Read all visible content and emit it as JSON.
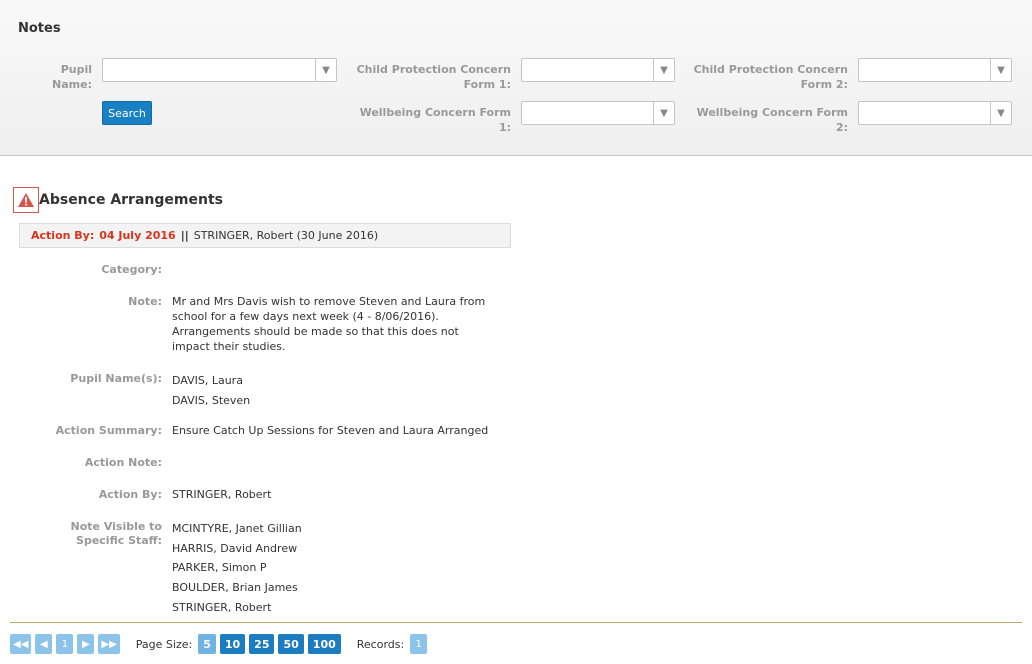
{
  "header": {
    "title": "Notes"
  },
  "filters": {
    "pupil_name": {
      "label_line1": "Pupil",
      "label_line2": "Name:",
      "value": ""
    },
    "cp_form1": {
      "label_line1": "Child Protection Concern",
      "label_line2": "Form 1:",
      "value": ""
    },
    "cp_form2": {
      "label_line1": "Child Protection Concern",
      "label_line2": "Form 2:",
      "value": ""
    },
    "wb_form1": {
      "label_line1": "Wellbeing Concern Form",
      "label_line2": "1:",
      "value": ""
    },
    "wb_form2": {
      "label_line1": "Wellbeing Concern Form",
      "label_line2": "2:",
      "value": ""
    },
    "search_label": "Search",
    "dropdown_icon": "chevron-down-icon"
  },
  "note": {
    "title": "Absence Arrangements",
    "alert_icon": "warning-icon",
    "alert_color": "#d9534f",
    "action_by_label": "Action By:",
    "action_by_date": "04 July 2016",
    "separator": "||",
    "author_info": "STRINGER, Robert (30 June 2016)",
    "fields": {
      "category_label": "Category:",
      "category_value": "",
      "note_label": "Note:",
      "note_lines": [
        "Mr and Mrs Davis wish to remove Steven and Laura from",
        "school for a few days next week (4 - 8/06/2016).",
        "Arrangements should be made so that this does not",
        "impact their studies."
      ],
      "pupils_label": "Pupil Name(s):",
      "pupils": [
        "DAVIS, Laura",
        "DAVIS, Steven"
      ],
      "action_summary_label": "Action Summary:",
      "action_summary": "Ensure Catch Up Sessions for Steven and Laura Arranged",
      "action_note_label": "Action Note:",
      "action_note": "",
      "action_by_label": "Action By:",
      "action_by": "STRINGER, Robert",
      "visible_label_line1": "Note Visible to",
      "visible_label_line2": "Specific Staff:",
      "visible_staff": [
        "MCINTYRE, Janet Gillian",
        "HARRIS, David Andrew",
        "PARKER, Simon P",
        "BOULDER, Brian James",
        "STRINGER, Robert"
      ]
    }
  },
  "pager": {
    "first_icon": "first-page-icon",
    "prev_icon": "prev-page-icon",
    "current_page": "1",
    "next_icon": "next-page-icon",
    "last_icon": "last-page-icon",
    "page_size_label": "Page Size:",
    "page_sizes": [
      "5",
      "10",
      "25",
      "50",
      "100"
    ],
    "records_label": "Records:",
    "records_value": "1"
  }
}
